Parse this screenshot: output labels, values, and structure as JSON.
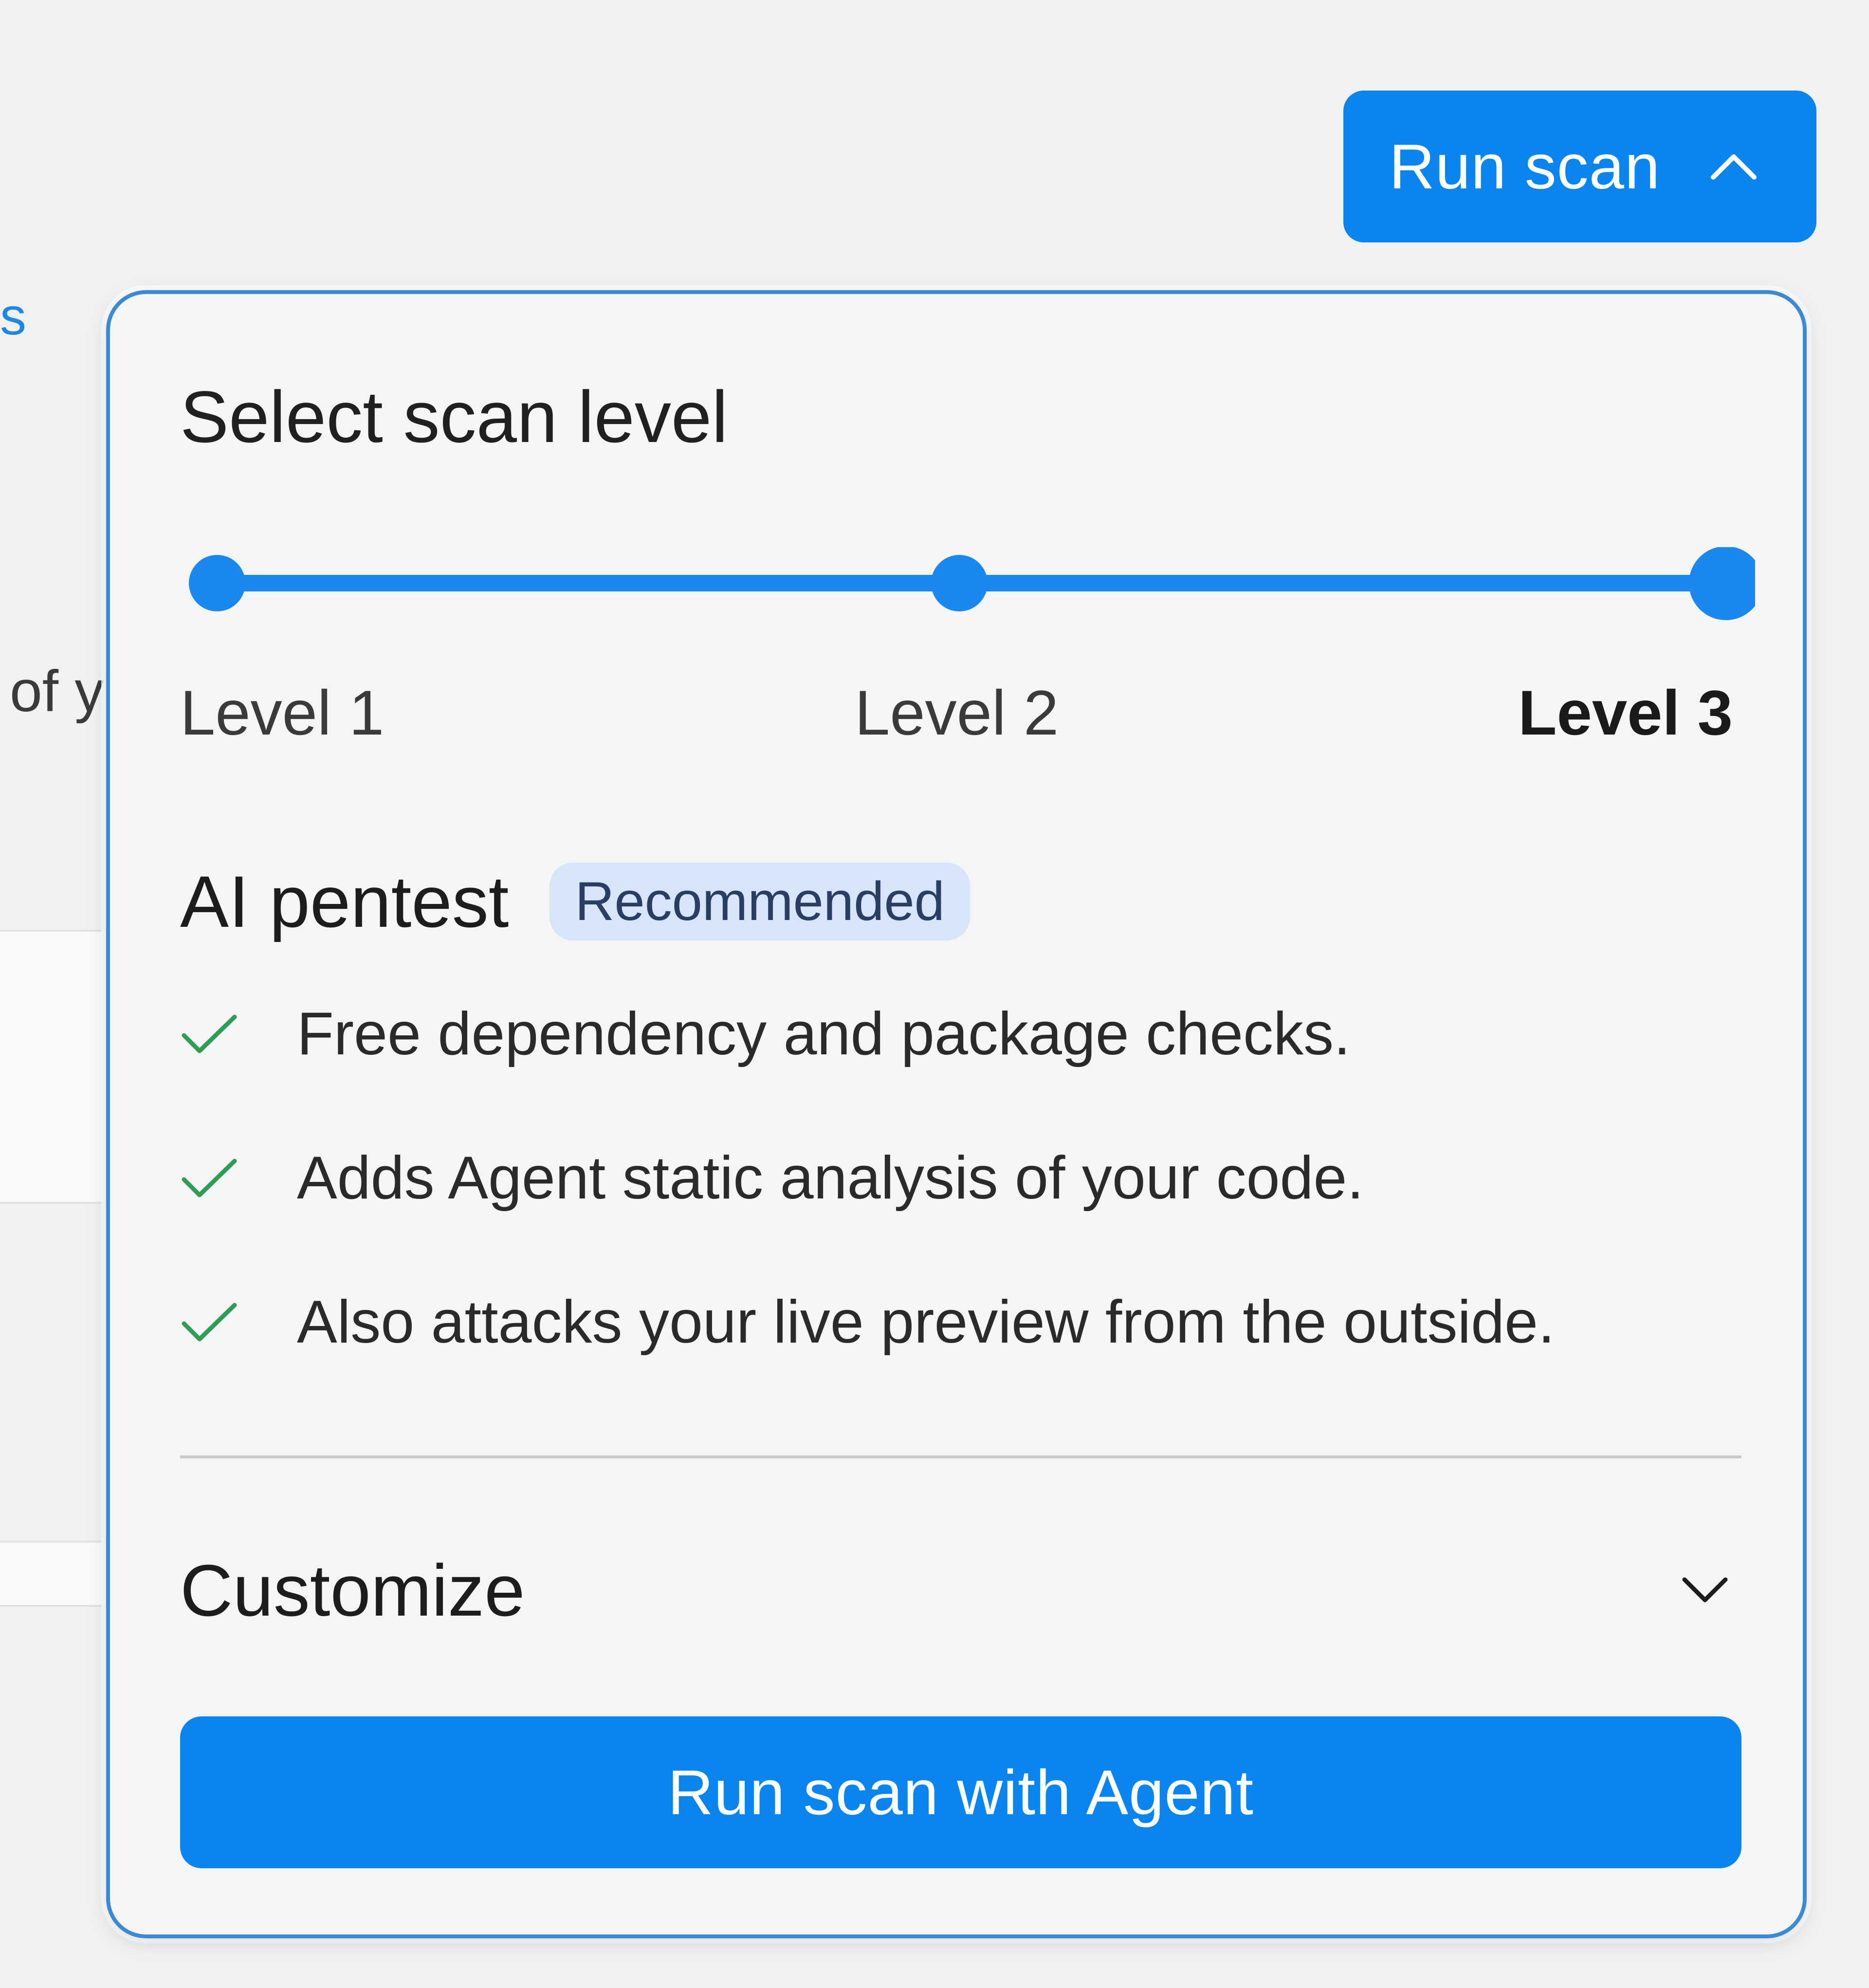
{
  "background": {
    "link_fragment": "s",
    "text_fragment": "of y"
  },
  "toolbar": {
    "run_scan_label": "Run scan",
    "run_scan_icon": "chevron-up-icon"
  },
  "popover": {
    "title": "Select scan level",
    "slider": {
      "levels": [
        "Level 1",
        "Level 2",
        "Level 3"
      ],
      "selected_index": 2,
      "accent_color": "#1b87f0"
    },
    "plan": {
      "name": "AI pentest",
      "badge": "Recommended"
    },
    "features": [
      "Free dependency and package checks.",
      "Adds Agent static analysis of your code.",
      "Also attacks your live preview from the outside."
    ],
    "feature_icon": "check-icon",
    "customize": {
      "label": "Customize",
      "icon": "chevron-down-icon"
    },
    "primary_action": "Run scan with Agent"
  },
  "colors": {
    "primary": "#0a85f0",
    "panel_border": "#3a8ad8",
    "check": "#2e9e54",
    "badge_bg": "#d6e5fa",
    "badge_text": "#2a3d62"
  }
}
